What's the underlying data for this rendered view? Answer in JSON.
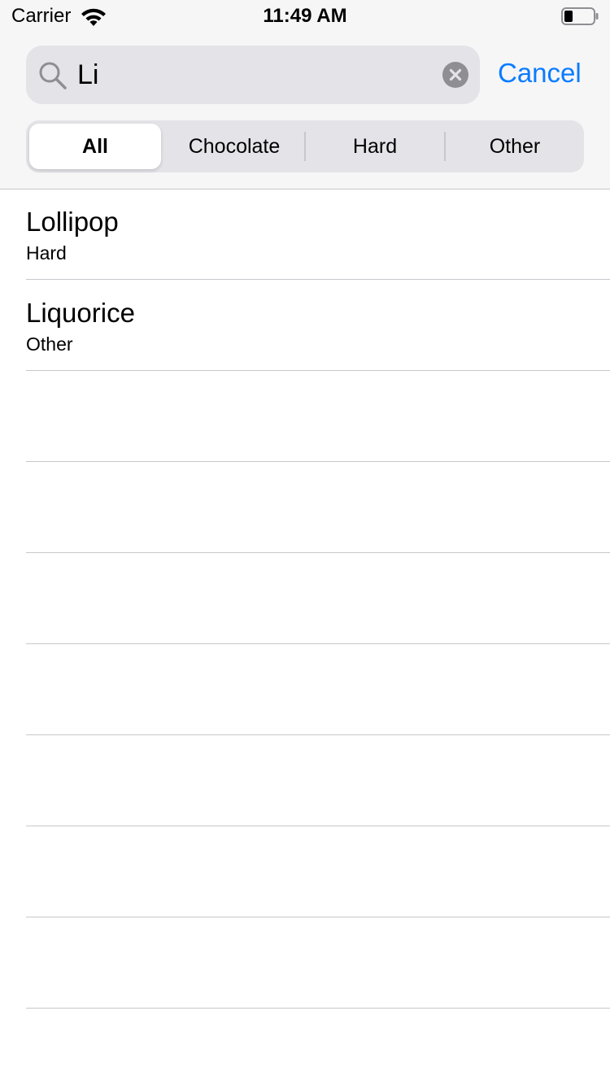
{
  "status_bar": {
    "carrier": "Carrier",
    "time": "11:49 AM",
    "wifi_icon": "wifi-icon",
    "battery_icon": "battery-icon"
  },
  "search": {
    "query": "Li",
    "search_icon": "magnifying-glass-icon",
    "clear_icon": "clear-circle-icon",
    "cancel_label": "Cancel"
  },
  "scope": {
    "options": [
      "All",
      "Chocolate",
      "Hard",
      "Other"
    ],
    "selected": "All"
  },
  "results": [
    {
      "title": "Lollipop",
      "category": "Hard"
    },
    {
      "title": "Liquorice",
      "category": "Other"
    }
  ],
  "colors": {
    "accent": "#0a7cff",
    "search_field_bg": "#e3e3e8",
    "header_bg": "#f6f6f7",
    "separator": "#c8c8cc"
  }
}
